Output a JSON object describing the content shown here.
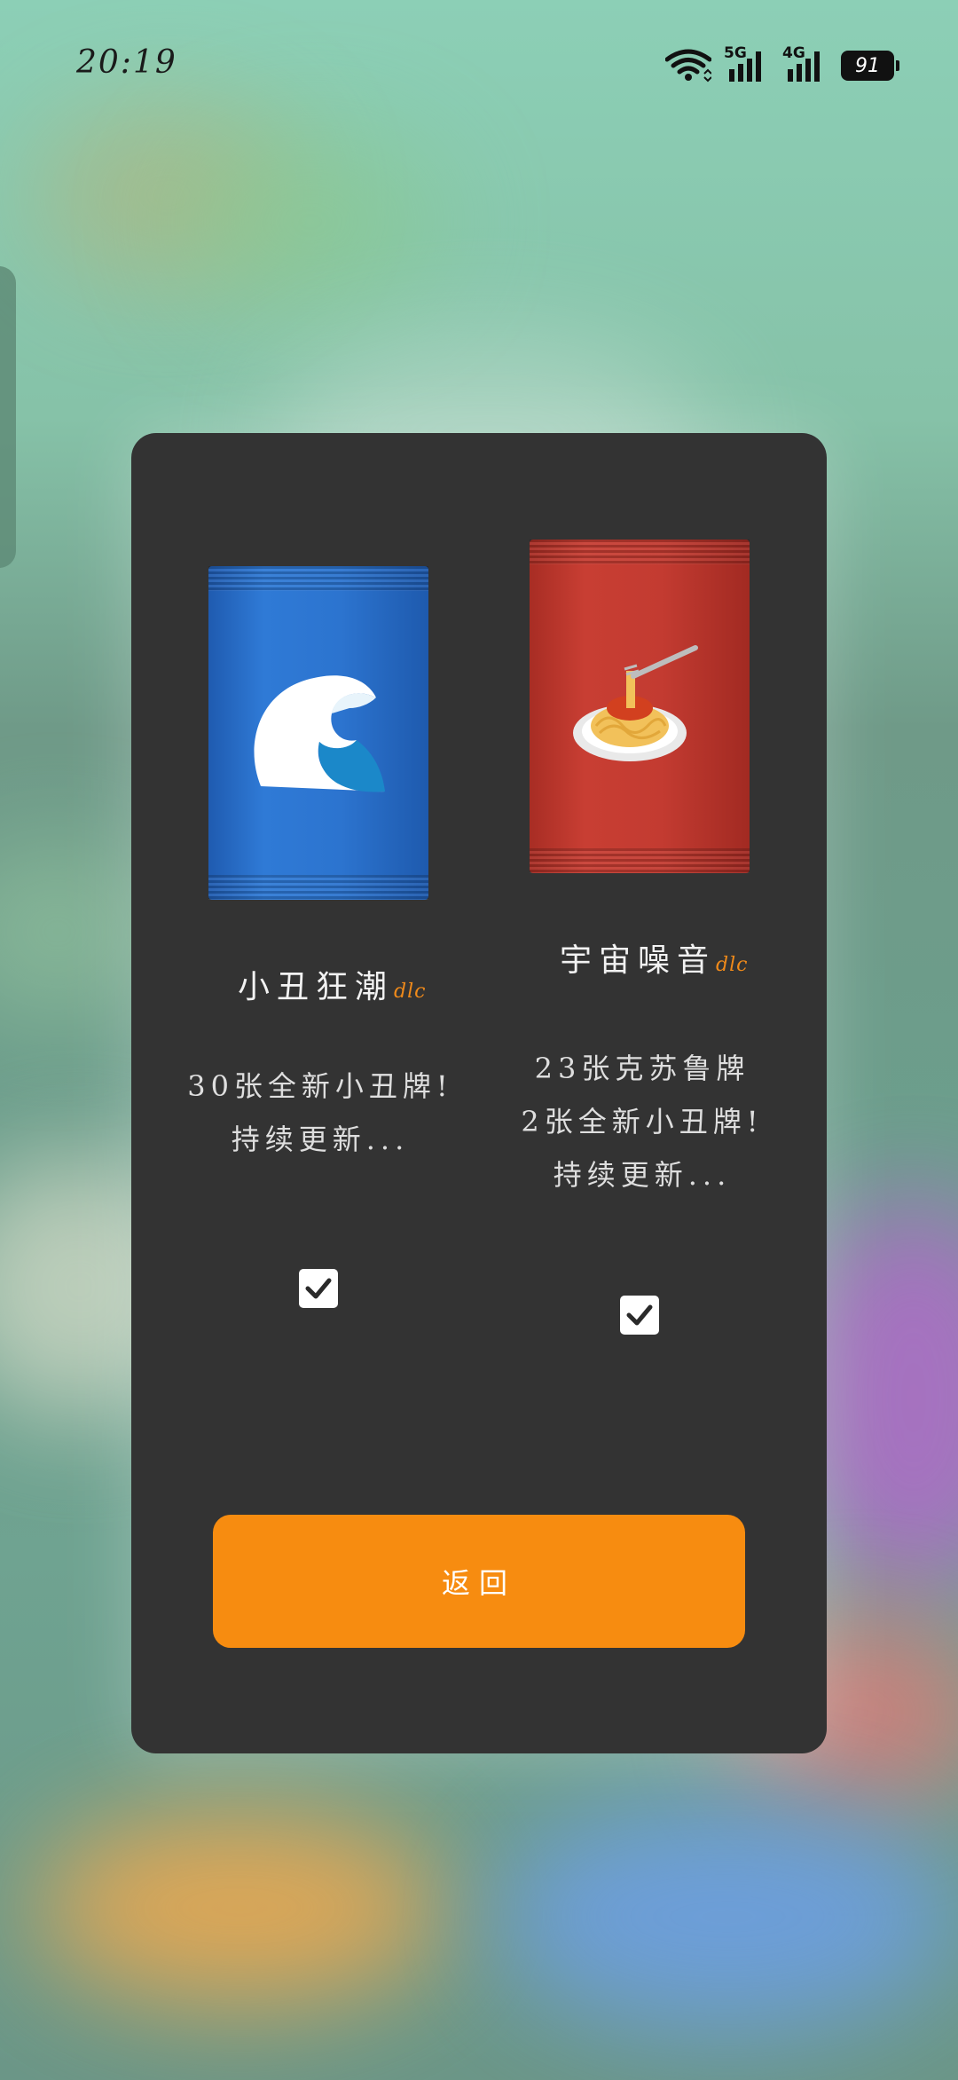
{
  "status_bar": {
    "time": "20:19",
    "battery": "91",
    "network_1": "5G",
    "network_2": "4G"
  },
  "dialog": {
    "packs": [
      {
        "icon": "wave-icon",
        "color": "#2c74cf",
        "title": "小丑狂潮",
        "tag": "dlc",
        "desc_lines": [
          "30张全新小丑牌!",
          "持续更新..."
        ],
        "checked": true
      },
      {
        "icon": "spaghetti-icon",
        "color": "#c33b31",
        "title": "宇宙噪音",
        "tag": "dlc",
        "desc_lines": [
          "23张克苏鲁牌",
          "2张全新小丑牌!",
          "持续更新..."
        ],
        "checked": true
      }
    ],
    "back_label": "返回"
  },
  "colors": {
    "dialog_bg": "#333333",
    "accent": "#f78c10",
    "dlc_tag": "#f08a1a"
  }
}
